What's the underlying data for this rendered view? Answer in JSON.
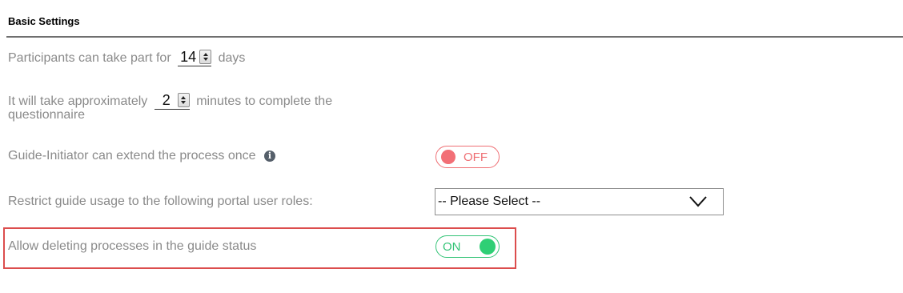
{
  "section": {
    "title": "Basic Settings"
  },
  "settings": {
    "participation": {
      "prefix": "Participants can take part for",
      "value": "14",
      "suffix": "days"
    },
    "duration": {
      "prefix": "It will take approximately",
      "value": "2",
      "suffix": "minutes to complete the",
      "suffix_line2": "questionnaire"
    },
    "extend": {
      "label": "Guide-Initiator can extend the process once",
      "info_icon": "i",
      "toggle_label": "OFF",
      "toggle_state": "off"
    },
    "restrict": {
      "label": "Restrict guide usage to the following portal user roles:",
      "select_value": "-- Please Select --"
    },
    "allow_delete": {
      "label": "Allow deleting processes in the guide status",
      "toggle_label": "ON",
      "toggle_state": "on"
    }
  },
  "colors": {
    "off": "#ef6f74",
    "on": "#34c477",
    "highlight": "#dc4d4d"
  }
}
